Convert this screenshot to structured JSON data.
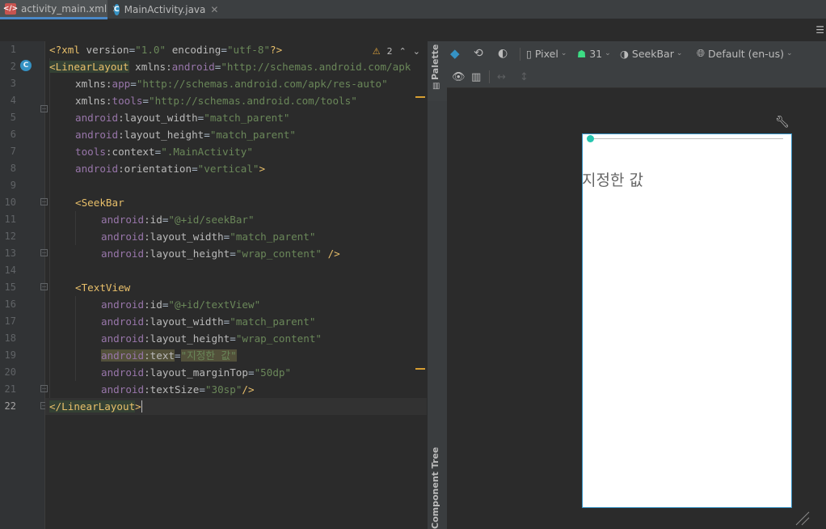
{
  "tabs": [
    {
      "label": "activity_main.xml",
      "icon": "xml-file-icon",
      "active": true
    },
    {
      "label": "MainActivity.java",
      "icon": "java-class-icon",
      "active": false
    }
  ],
  "editor": {
    "inspection": {
      "warnings": "2"
    },
    "line_numbers": [
      "1",
      "2",
      "3",
      "4",
      "5",
      "6",
      "7",
      "8",
      "9",
      "10",
      "11",
      "12",
      "13",
      "14",
      "15",
      "16",
      "17",
      "18",
      "19",
      "20",
      "21",
      "22"
    ],
    "current_line": "22"
  },
  "side_tabs": {
    "palette": "Palette",
    "component_tree": "Component Tree"
  },
  "design_toolbar": {
    "device": "Pixel",
    "api": "31",
    "theme": "SeekBar",
    "locale": "Default (en-us)"
  },
  "preview": {
    "text": "지정한 값",
    "colors": {
      "thumb": "#26c6b0",
      "border": "#3592c4",
      "text": "#666666"
    }
  },
  "code_tokens": {
    "l1_a": "<?xml ",
    "l1_b": "version",
    "l1_c": "=",
    "l1_d": "\"1.0\"",
    "l1_e": " ",
    "l1_f": "encoding",
    "l1_g": "=",
    "l1_h": "\"utf-8\"",
    "l1_i": "?>",
    "l2_a": "<LinearLayout",
    "l2_b": " xmlns:",
    "l2_c": "android",
    "l2_d": "=",
    "l2_e": "\"http://schemas.android.com/apk",
    "l3_a": "xmlns:",
    "l3_b": "app",
    "l3_c": "=",
    "l3_d": "\"http://schemas.android.com/apk/res-auto\"",
    "l4_a": "xmlns:",
    "l4_b": "tools",
    "l4_c": "=",
    "l4_d": "\"http://schemas.android.com/tools\"",
    "l5_a": "android",
    "l5_b": ":layout_width",
    "l5_c": "=",
    "l5_d": "\"match_parent\"",
    "l6_a": "android",
    "l6_b": ":layout_height",
    "l6_c": "=",
    "l6_d": "\"match_parent\"",
    "l7_a": "tools",
    "l7_b": ":context",
    "l7_c": "=",
    "l7_d": "\".MainActivity\"",
    "l8_a": "android",
    "l8_b": ":orientation",
    "l8_c": "=",
    "l8_d": "\"vertical\"",
    "l8_e": ">",
    "l10_a": "<SeekBar",
    "l11_a": "android",
    "l11_b": ":id",
    "l11_c": "=",
    "l11_d": "\"@+id/seekBar\"",
    "l12_a": "android",
    "l12_b": ":layout_width",
    "l12_c": "=",
    "l12_d": "\"match_parent\"",
    "l13_a": "android",
    "l13_b": ":layout_height",
    "l13_c": "=",
    "l13_d": "\"wrap_content\"",
    "l13_e": " />",
    "l15_a": "<TextView",
    "l16_a": "android",
    "l16_b": ":id",
    "l16_c": "=",
    "l16_d": "\"@+id/textView\"",
    "l17_a": "android",
    "l17_b": ":layout_width",
    "l17_c": "=",
    "l17_d": "\"match_parent\"",
    "l18_a": "android",
    "l18_b": ":layout_height",
    "l18_c": "=",
    "l18_d": "\"wrap_content\"",
    "l19_a": "android",
    "l19_b": ":text",
    "l19_c": "=",
    "l19_d": "\"지정한 값\"",
    "l20_a": "android",
    "l20_b": ":layout_marginTop",
    "l20_c": "=",
    "l20_d": "\"50dp\"",
    "l21_a": "android",
    "l21_b": ":textSize",
    "l21_c": "=",
    "l21_d": "\"30sp\"",
    "l21_e": "/>",
    "l22_a": "</LinearLayout",
    "l22_b": ">"
  }
}
